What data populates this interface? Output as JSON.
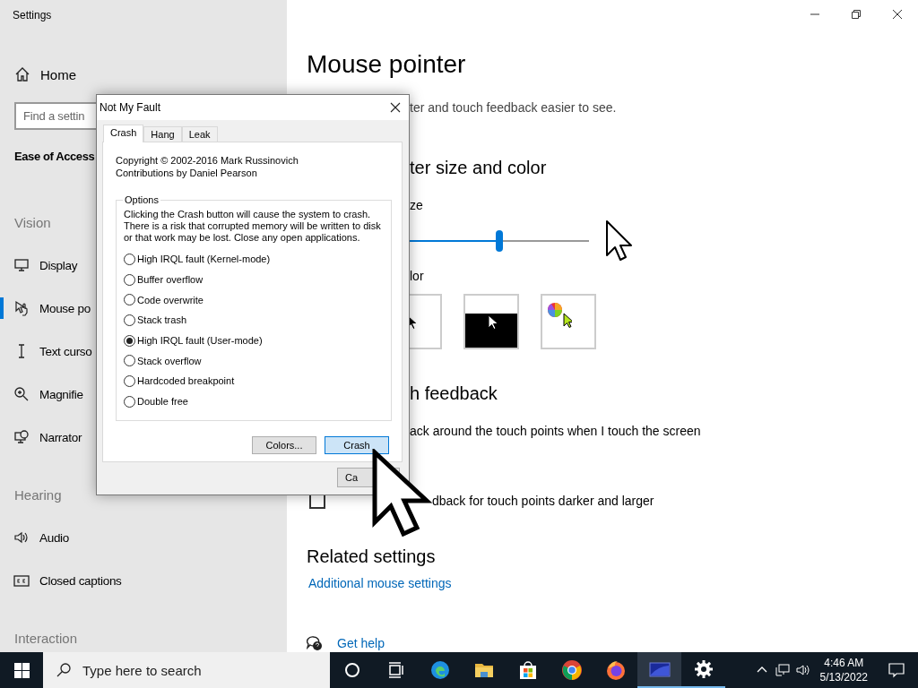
{
  "window": {
    "title": "Settings"
  },
  "sidebar": {
    "home": "Home",
    "search": {
      "placeholder": "Find a settin"
    },
    "section_title": "Ease of Access",
    "groups": [
      {
        "heading": "Vision",
        "items": [
          {
            "label": "Display",
            "selected": false
          },
          {
            "label": "Mouse po",
            "selected": true
          },
          {
            "label": "Text curso",
            "selected": false
          },
          {
            "label": "Magnifie",
            "selected": false
          },
          {
            "label": "Narrator",
            "selected": false
          }
        ]
      },
      {
        "heading": "Hearing",
        "items": [
          {
            "label": "Audio",
            "selected": false
          },
          {
            "label": "Closed captions",
            "selected": false
          }
        ]
      },
      {
        "heading": "Interaction"
      }
    ]
  },
  "content": {
    "title": "Mouse pointer",
    "subtitle": "ter and touch feedback easier to see.",
    "size_color_heading": "ter size and color",
    "size_label": "ze",
    "size_slider": {
      "level": 0.68
    },
    "color_label": "lor",
    "color_tiles": [
      {
        "kind": "black"
      },
      {
        "kind": "inverted"
      },
      {
        "kind": "custom"
      }
    ],
    "touch_heading": "h feedback",
    "touch_text": "ack around the touch points when I touch the screen",
    "darker_option": {
      "checked": false,
      "label": "dback for touch points darker and larger"
    },
    "related_heading": "Related settings",
    "related_link": "Additional mouse settings",
    "help_link": "Get help"
  },
  "dialog": {
    "title": "Not My Fault",
    "tabs": [
      {
        "label": "Crash",
        "selected": true
      },
      {
        "label": "Hang",
        "selected": false
      },
      {
        "label": "Leak",
        "selected": false
      }
    ],
    "copyright": "Copyright © 2002-2016 Mark Russinovich",
    "contributions": "Contributions by Daniel Pearson",
    "group_label": "Options",
    "description": "Clicking the Crash button will cause the system to crash. There is a risk that corrupted memory will be written to disk or that work may be lost. Close any open applications.",
    "options": [
      {
        "label": "High IRQL fault (Kernel-mode)",
        "selected": false
      },
      {
        "label": "Buffer overflow",
        "selected": false
      },
      {
        "label": "Code overwrite",
        "selected": false
      },
      {
        "label": "Stack trash",
        "selected": false
      },
      {
        "label": "High IRQL fault (User-mode)",
        "selected": true
      },
      {
        "label": "Stack overflow",
        "selected": false
      },
      {
        "label": "Hardcoded breakpoint",
        "selected": false
      },
      {
        "label": "Double free",
        "selected": false
      }
    ],
    "buttons": [
      {
        "label": "Colors...",
        "default": false
      },
      {
        "label": "Crash",
        "default": true
      }
    ],
    "cancel_button": "Ca"
  },
  "taskbar": {
    "search_placeholder": "Type here to search",
    "apps": [
      {
        "kind": "cortana",
        "running": false,
        "active": false
      },
      {
        "kind": "taskview",
        "running": false,
        "active": false
      },
      {
        "kind": "edge",
        "running": false,
        "active": false
      },
      {
        "kind": "explorer",
        "running": false,
        "active": false
      },
      {
        "kind": "store",
        "running": false,
        "active": false
      },
      {
        "kind": "chrome",
        "running": false,
        "active": false
      },
      {
        "kind": "firefox",
        "running": false,
        "active": false
      },
      {
        "kind": "window",
        "running": true,
        "active": true
      },
      {
        "kind": "settings",
        "running": true,
        "active": false
      }
    ],
    "time": "4:46 AM",
    "date": "5/13/2022"
  }
}
